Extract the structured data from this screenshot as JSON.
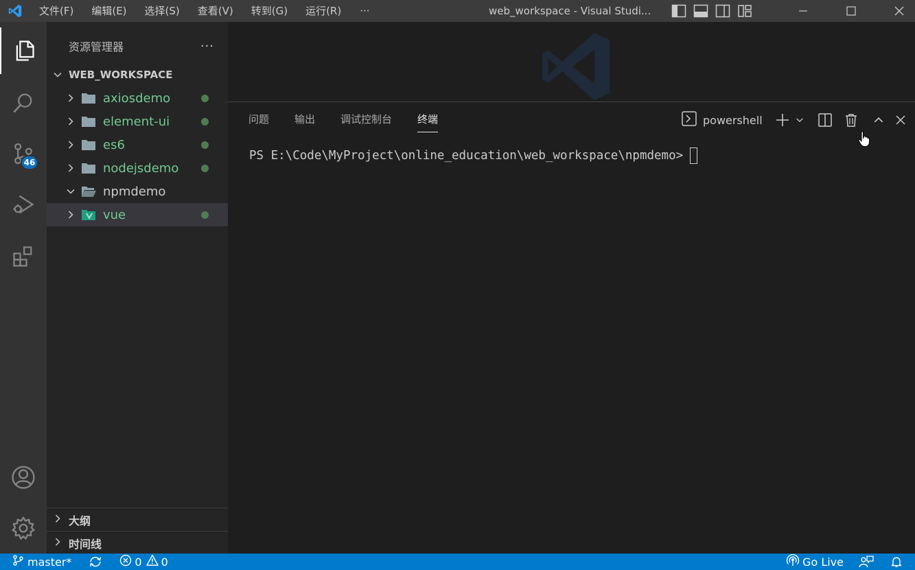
{
  "titlebar": {
    "menu": [
      "文件(F)",
      "编辑(E)",
      "选择(S)",
      "查看(V)",
      "转到(G)",
      "运行(R)"
    ],
    "more": "···",
    "title": "web_workspace - Visual Studi..."
  },
  "activity": {
    "icons": [
      "explorer-icon",
      "search-icon",
      "source-control-icon",
      "run-debug-icon",
      "extensions-icon",
      "account-icon",
      "gear-icon"
    ],
    "scm_badge": "46"
  },
  "sidebar": {
    "title": "资源管理器",
    "more": "···",
    "workspace": "WEB_WORKSPACE",
    "items": [
      {
        "label": "axiosdemo",
        "color": "#73c991",
        "expanded": false
      },
      {
        "label": "element-ui",
        "color": "#73c991",
        "expanded": false
      },
      {
        "label": "es6",
        "color": "#73c991",
        "expanded": false
      },
      {
        "label": "nodejsdemo",
        "color": "#73c991",
        "expanded": false
      },
      {
        "label": "npmdemo",
        "color": "#cccccc",
        "expanded": true
      },
      {
        "label": "vue",
        "color": "#73c991",
        "expanded": false
      }
    ],
    "outline": "大纲",
    "timeline": "时间线"
  },
  "panel": {
    "tabs": [
      "问题",
      "输出",
      "调试控制台",
      "终端"
    ],
    "active_tab": "终端",
    "terminal_name": "powershell",
    "prompt": "PS E:\\Code\\MyProject\\online_education\\web_workspace\\npmdemo>"
  },
  "statusbar": {
    "branch": "master*",
    "errors": "0",
    "warnings": "0",
    "golive": "Go Live"
  },
  "colors": {
    "accent": "#007acc",
    "git_modified": "#73c991"
  }
}
